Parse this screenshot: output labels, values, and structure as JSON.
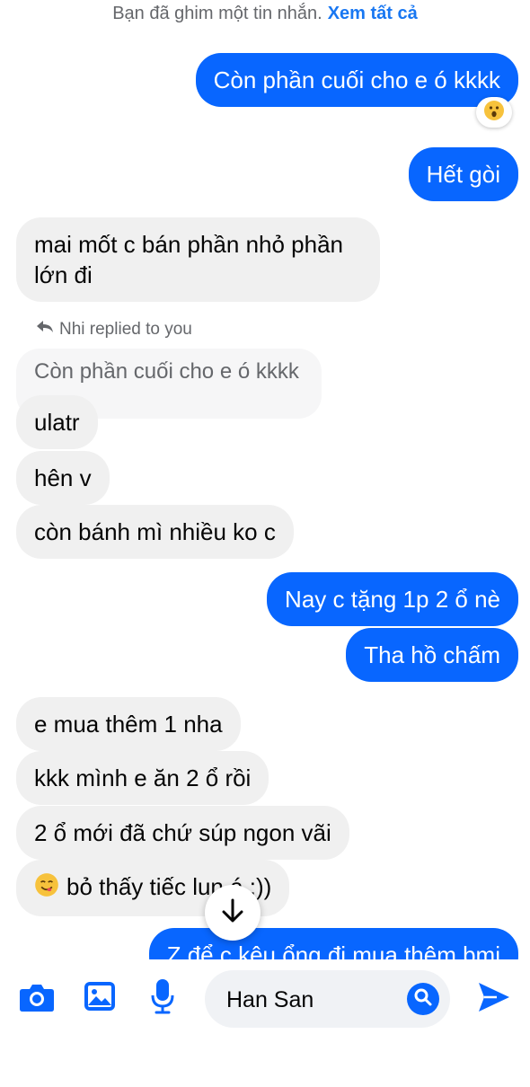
{
  "pinned": {
    "text": "Bạn đã ghim một tin nhắn.",
    "link": "Xem tất cả"
  },
  "messages": [
    {
      "dir": "out",
      "text": "Còn phần cuối cho e ó kkkk",
      "reaction": "😮"
    },
    {
      "dir": "out",
      "text": "Hết gòi"
    },
    {
      "dir": "in",
      "text": "mai mốt c bán phần nhỏ phần lớn đi"
    },
    {
      "dir": "in",
      "text": "ulatr"
    },
    {
      "dir": "in",
      "text": "hên v"
    },
    {
      "dir": "in",
      "text": "còn bánh mì nhiều ko c"
    },
    {
      "dir": "out",
      "text": "Nay c tặng 1p 2 ổ nè"
    },
    {
      "dir": "out",
      "text": "Tha hồ chấm"
    },
    {
      "dir": "in",
      "text": "e mua thêm 1 nha"
    },
    {
      "dir": "in",
      "text": "kkk mình e ăn 2 ổ rồi"
    },
    {
      "dir": "in",
      "text": "2 ổ mới đã chứ súp ngon vãi"
    },
    {
      "dir": "in",
      "text": "bỏ thấy tiếc lun á :))",
      "emoji": "😋"
    },
    {
      "dir": "out",
      "text": "Z để c kêu ổng đi mua thêm bmi"
    }
  ],
  "reply": {
    "meta": "Nhi replied to you",
    "quoted": "Còn phần cuối cho e ó kkkk"
  },
  "composer": {
    "input_value": "Han San"
  },
  "icons": {
    "camera": "camera-icon",
    "gallery": "image-icon",
    "mic": "microphone-icon",
    "search": "search-icon",
    "send": "send-icon",
    "scroll": "arrow-down-icon",
    "reply": "reply-arrow-icon"
  },
  "colors": {
    "outgoing_bubble": "#0866ff",
    "incoming_bubble": "#f0f0f0",
    "accent": "#0866ff"
  }
}
